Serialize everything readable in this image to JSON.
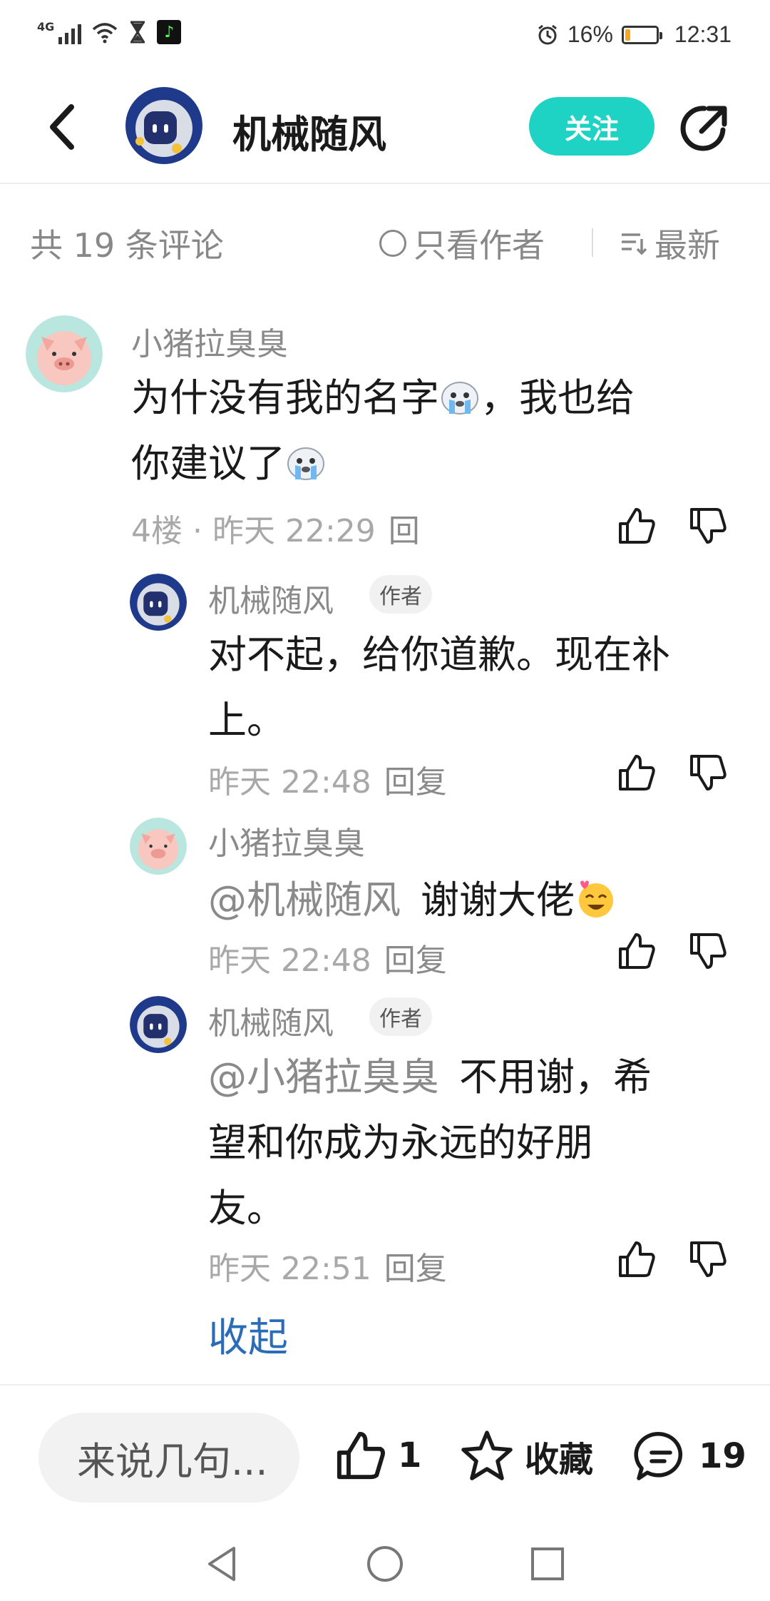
{
  "status_bar": {
    "network": "4G",
    "alarm_icon": "alarm-clock-icon",
    "battery_percent": "16%",
    "battery_level": 0.16,
    "time": "12:31"
  },
  "header": {
    "author_name": "机械随风",
    "follow_label": "关注",
    "accent_color": "#1ed2c4"
  },
  "filter": {
    "total_label": "共 19 条评论",
    "author_only_label": "只看作者",
    "sort_label": "最新"
  },
  "comments": [
    {
      "name": "小猪拉臭臭",
      "avatar": "pig-avatar",
      "body_lines": [
        "为什没有我的名字",
        "，我也给",
        "你建议了"
      ],
      "emoji": "crying-seal-emoji",
      "floor": "4楼",
      "time": "昨天 22:29",
      "reply_label": "回"
    },
    {
      "name": "机械随风",
      "avatar": "robot-avatar",
      "tag": "作者",
      "body_lines": [
        "对不起，给你道歉。现在补",
        "上。"
      ],
      "time": "昨天 22:48",
      "reply_label": "回复"
    },
    {
      "name": "小猪拉臭臭",
      "avatar": "pig-avatar",
      "mention": "@机械随风",
      "body": "谢谢大佬",
      "emoji": "heart-smile-emoji",
      "time": "昨天 22:48",
      "reply_label": "回复"
    },
    {
      "name": "机械随风",
      "avatar": "robot-avatar",
      "tag": "作者",
      "mention": "@小猪拉臭臭",
      "body_lines": [
        "不用谢，希",
        "望和你成为永远的好朋",
        "友。"
      ],
      "time": "昨天 22:51",
      "reply_label": "回复"
    }
  ],
  "collapse_label": "收起",
  "bottom_bar": {
    "input_placeholder": "来说几句...",
    "like_count": "1",
    "favorite_label": "收藏",
    "comment_count": "19"
  }
}
